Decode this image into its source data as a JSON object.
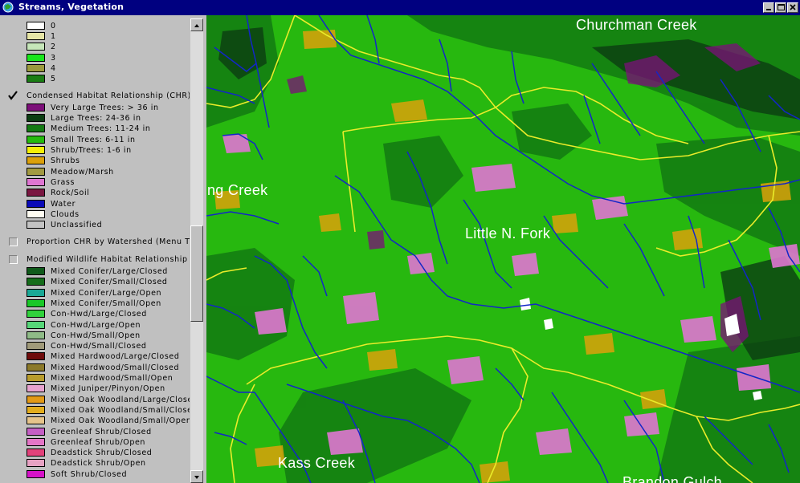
{
  "window": {
    "title": "Streams, Vegetation"
  },
  "legend": {
    "layer0_items": [
      {
        "label": "0",
        "color": "#ffffff"
      },
      {
        "label": "1",
        "color": "#e7e6a6"
      },
      {
        "label": "2",
        "color": "#c6e6b9"
      },
      {
        "label": "3",
        "color": "#19e61c"
      },
      {
        "label": "4",
        "color": "#9a9a3c"
      },
      {
        "label": "5",
        "color": "#1a7d14"
      }
    ],
    "chr_layer": {
      "label": "Condensed Habitat Relationship (CHR)",
      "checked": true,
      "items": [
        {
          "label": "Very Large Trees: > 36 in",
          "color": "#7c0f79"
        },
        {
          "label": "Large Trees: 24-36 in",
          "color": "#0b3d12"
        },
        {
          "label": "Medium Trees: 11-24 in",
          "color": "#137a12"
        },
        {
          "label": "Small Trees: 6-11 in",
          "color": "#25bb0e"
        },
        {
          "label": "Shrub/Trees: 1-6 in",
          "color": "#f7ef06"
        },
        {
          "label": "Shrubs",
          "color": "#dca10b"
        },
        {
          "label": "Meadow/Marsh",
          "color": "#a29a42"
        },
        {
          "label": "Grass",
          "color": "#df76d2"
        },
        {
          "label": "Rock/Soil",
          "color": "#7a1741"
        },
        {
          "label": "Water",
          "color": "#0a0ab8"
        },
        {
          "label": "Clouds",
          "color": "#fffdf2"
        },
        {
          "label": "Unclassified",
          "color": "#c4c4c4"
        }
      ]
    },
    "proportion_layer": {
      "label": "Proportion CHR by Watershed (Menu T",
      "checked": false
    },
    "mwhr_layer": {
      "label": "Modified Wildlife Habitat Relationship (W",
      "checked": false,
      "items": [
        {
          "label": "Mixed Conifer/Large/Closed",
          "color": "#0f5a1a"
        },
        {
          "label": "Mixed Conifer/Small/Closed",
          "color": "#156d1b"
        },
        {
          "label": "Mixed Conifer/Large/Open",
          "color": "#1aa896"
        },
        {
          "label": "Mixed Conifer/Small/Open",
          "color": "#19c828"
        },
        {
          "label": "Con-Hwd/Large/Closed",
          "color": "#30d23c"
        },
        {
          "label": "Con-Hwd/Large/Open",
          "color": "#56d678"
        },
        {
          "label": "Con-Hwd/Small/Open",
          "color": "#8fbb87"
        },
        {
          "label": "Con-Hwd/Small/Closed",
          "color": "#a09a7a"
        },
        {
          "label": "Mixed Hardwood/Large/Closed",
          "color": "#6e0b0b"
        },
        {
          "label": "Mixed Hardwood/Small/Closed",
          "color": "#8c7a2a"
        },
        {
          "label": "Mixed Hardwood/Small/Open",
          "color": "#b89c2c"
        },
        {
          "label": "Mixed Juniper/Pinyon/Open",
          "color": "#e7a3cf"
        },
        {
          "label": "Mixed Oak Woodland/Large/Closed",
          "color": "#e39a17"
        },
        {
          "label": "Mixed Oak Woodland/Small/Closed",
          "color": "#e3ad1e"
        },
        {
          "label": "Mixed Oak Woodland/Small/Open",
          "color": "#e6c48b"
        },
        {
          "label": "Greenleaf Shrub/Closed",
          "color": "#c55fc4"
        },
        {
          "label": "Greenleaf Shrub/Open",
          "color": "#e476c6"
        },
        {
          "label": "Deadstick Shrub/Closed",
          "color": "#e2427a"
        },
        {
          "label": "Deadstick Shrub/Open",
          "color": "#e7a2c3"
        },
        {
          "label": "Soft Shrub/Closed",
          "color": "#d511c7"
        }
      ]
    }
  },
  "map": {
    "labels": [
      {
        "text": "Churchman Creek"
      },
      {
        "text": "ng Creek"
      },
      {
        "text": "Little N. Fork"
      },
      {
        "text": "Kass Creek"
      },
      {
        "text": "Brandon Gulch"
      }
    ],
    "colors": {
      "stream": "#1226c8",
      "boundary": "#eaec2a",
      "background": "#27b80f"
    }
  },
  "icons": {
    "app": "map-window-icon",
    "minimize": "minimize-icon",
    "maximize": "maximize-icon",
    "close": "close-icon"
  }
}
